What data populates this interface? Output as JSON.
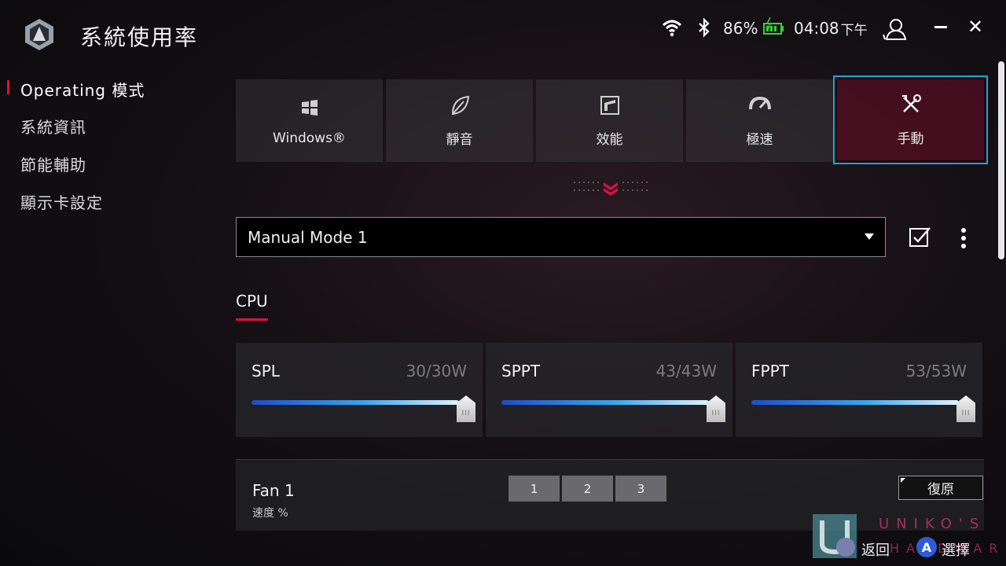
{
  "header": {
    "title": "系統使用率",
    "battery_percent": "86%",
    "time": "04:08",
    "ampm": "下午",
    "close_glyph": "✕"
  },
  "sidebar": {
    "items": [
      {
        "label": "Operating 模式",
        "active": true
      },
      {
        "label": "系統資訊"
      },
      {
        "label": "節能輔助"
      },
      {
        "label": "顯示卡設定"
      }
    ]
  },
  "modes": [
    {
      "label": "Windows®",
      "icon": "windows-icon"
    },
    {
      "label": "靜音",
      "icon": "leaf-icon"
    },
    {
      "label": "效能",
      "icon": "performance-icon"
    },
    {
      "label": "極速",
      "icon": "speedometer-icon"
    },
    {
      "label": "手動",
      "icon": "tools-icon",
      "active": true
    }
  ],
  "profile": {
    "selected": "Manual Mode 1"
  },
  "section_tab": "CPU",
  "sliders": [
    {
      "name": "SPL",
      "value": "30/30W",
      "fraction": 1.0
    },
    {
      "name": "SPPT",
      "value": "43/43W",
      "fraction": 1.0
    },
    {
      "name": "FPPT",
      "value": "53/53W",
      "fraction": 1.0
    }
  ],
  "slider_thumb_glyph": "III",
  "fan": {
    "title": "Fan 1",
    "subtitle": "速度 %",
    "segments": [
      "1",
      "2",
      "3"
    ],
    "restore_label": "復原"
  },
  "footer": {
    "brand_line1": "UNIKO'S",
    "brand_line2": "HARDWARE",
    "back_label": "返回",
    "a_glyph": "A",
    "select_label": "選擇"
  },
  "colors": {
    "accent_red": "#e0103a",
    "active_border": "#1aa6d8",
    "slider_gradient_start": "#1f4cc8",
    "slider_gradient_end": "#dff4ff"
  }
}
